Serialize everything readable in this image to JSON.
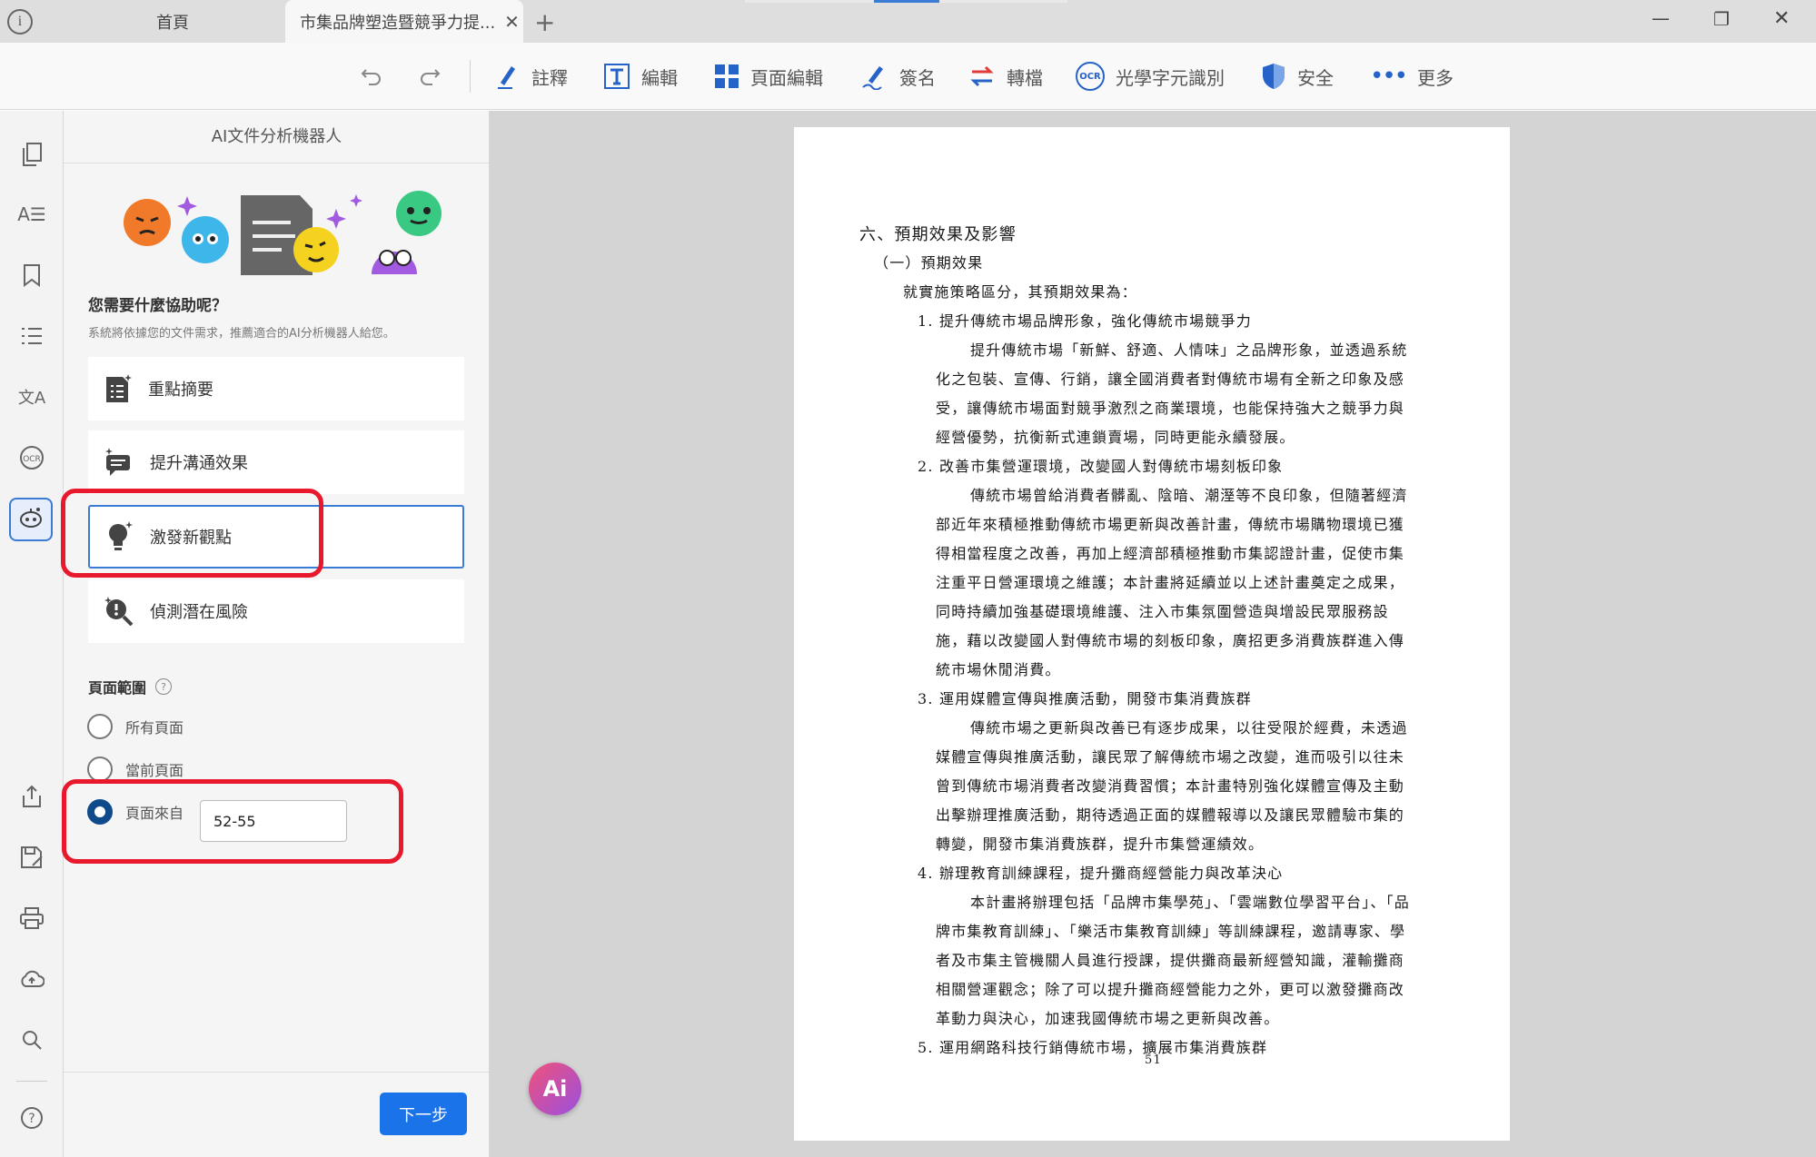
{
  "titlebar": {
    "info_icon": "info-icon",
    "tab_home": "首頁",
    "tab_doc": "市集品牌塑造暨競爭力提...",
    "new_tab": "+",
    "minimize": "—",
    "restore": "❐",
    "close": "✕"
  },
  "toolbar": {
    "annotate": "註釋",
    "edit": "編輯",
    "page_edit": "頁面編輯",
    "sign": "簽名",
    "convert": "轉檔",
    "ocr": "光學字元識別",
    "ocr_badge": "OCR",
    "security": "安全",
    "more": "更多"
  },
  "panel": {
    "title": "AI文件分析機器人",
    "question": "您需要什麼協助呢？",
    "hint": "系統將依據您的文件需求，推薦適合的AI分析機器人給您。",
    "options": [
      {
        "label": "重點摘要",
        "icon": "summary-icon"
      },
      {
        "label": "提升溝通效果",
        "icon": "chat-icon"
      },
      {
        "label": "激發新觀點",
        "icon": "lightbulb-icon"
      },
      {
        "label": "偵測潛在風險",
        "icon": "risk-search-icon"
      }
    ],
    "range_title": "頁面範圍",
    "range_all": "所有頁面",
    "range_current": "當前頁面",
    "range_from": "頁面來自",
    "range_value": "52-55",
    "next": "下一步"
  },
  "ai_button": "Ai",
  "document": {
    "lines": [
      "六、預期效果及影響",
      "（一）預期效果",
      "就實施策略區分，其預期效果為：",
      "1. 提升傳統市場品牌形象，強化傳統市場競爭力",
      "提升傳統市場「新鮮、舒適、人情味」之品牌形象，並透過系統",
      "化之包裝、宣傳、行銷，讓全國消費者對傳統市場有全新之印象及感",
      "受，讓傳統市場面對競爭激烈之商業環境，也能保持強大之競爭力與",
      "經營優勢，抗衡新式連鎖賣場，同時更能永續發展。",
      "2. 改善市集營運環境，改變國人對傳統市場刻板印象",
      "傳統市場曾給消費者髒亂、陰暗、潮溼等不良印象，但隨著經濟",
      "部近年來積極推動傳統市場更新與改善計畫，傳統市場購物環境已獲",
      "得相當程度之改善，再加上經濟部積極推動市集認證計畫，促使市集",
      "注重平日營運環境之維護；本計畫將延續並以上述計畫奠定之成果，",
      "同時持續加強基礎環境維護、注入市集氛圍營造與增設民眾服務設",
      "施，藉以改變國人對傳統市場的刻板印象，廣招更多消費族群進入傳",
      "統市場休閒消費。",
      "3. 運用媒體宣傳與推廣活動，開發市集消費族群",
      "傳統市場之更新與改善已有逐步成果，以往受限於經費，未透過",
      "媒體宣傳與推廣活動，讓民眾了解傳統市場之改變，進而吸引以往未",
      "曾到傳統市場消費者改變消費習慣；本計畫特別強化媒體宣傳及主動",
      "出擊辦理推廣活動，期待透過正面的媒體報導以及讓民眾體驗市集的",
      "轉變，開發市集消費族群，提升市集營運績效。",
      "4. 辦理教育訓練課程，提升攤商經營能力與改革決心",
      "本計畫將辦理包括「品牌市集學苑」、「雲端數位學習平台」、「品",
      "牌市集教育訓練」、「樂活市集教育訓練」等訓練課程，邀請專家、學",
      "者及市集主管機關人員進行授課，提供攤商最新經營知識，灌輸攤商",
      "相關營運觀念；除了可以提升攤商經營能力之外，更可以激發攤商改",
      "革動力與決心，加速我國傳統市場之更新與改善。",
      "5. 運用網路科技行銷傳統市場，擴展市集消費族群"
    ],
    "page_number": "51"
  }
}
